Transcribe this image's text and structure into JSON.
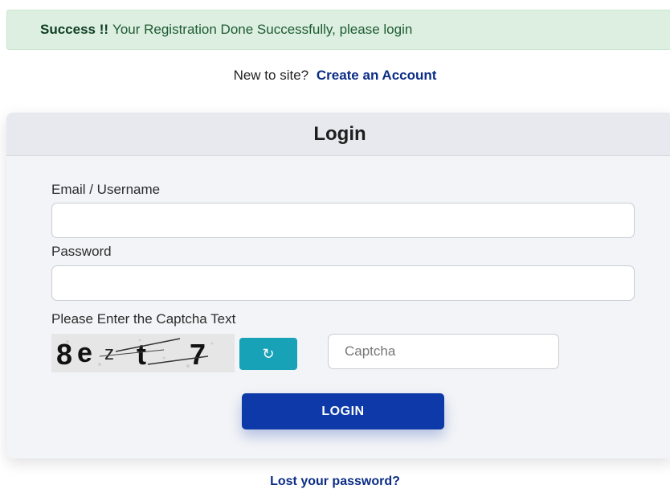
{
  "alert": {
    "strong": "Success !!",
    "message": "Your Registration Done Successfully, please login",
    "color": "#dcefe1"
  },
  "signup": {
    "prompt": "New to site?",
    "link": "Create an Account"
  },
  "login_card": {
    "title": "Login",
    "email_label": "Email / Username",
    "password_label": "Password",
    "captcha_label": "Please Enter the Captcha Text",
    "captcha_text": "8ezt7",
    "refresh_icon": "refresh-icon",
    "captcha_placeholder": "Captcha",
    "submit_label": "LOGIN",
    "accent": "#0d3aa8"
  },
  "lost_password": "Lost your password?"
}
